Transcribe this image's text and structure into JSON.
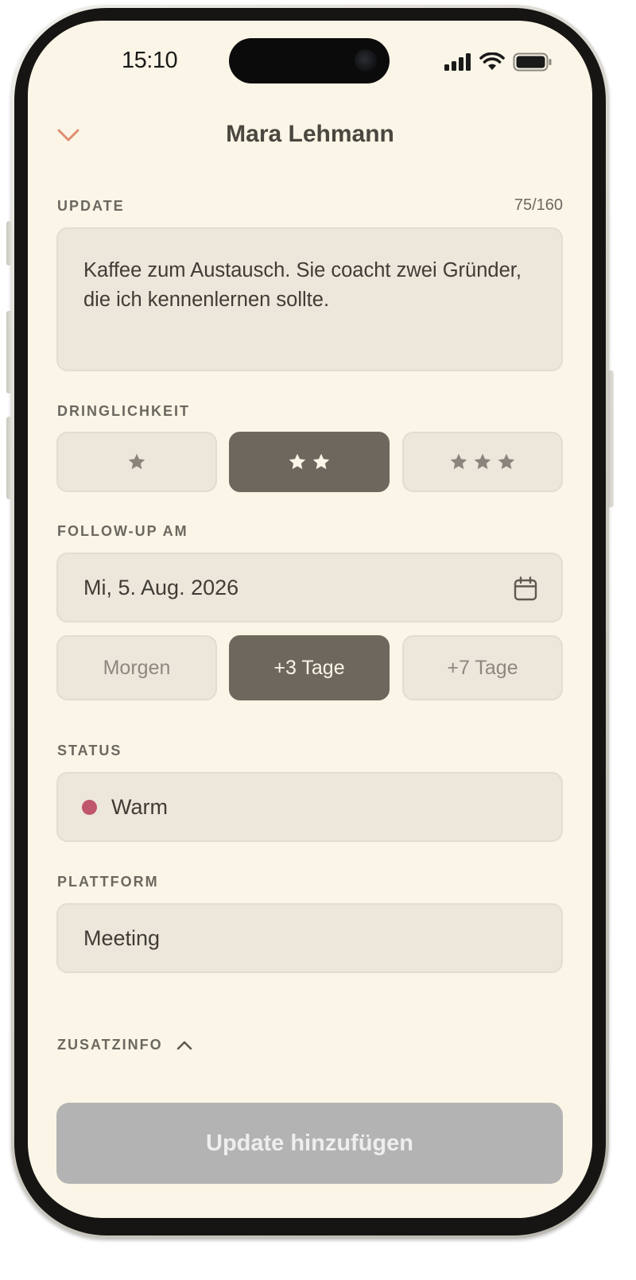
{
  "status_bar": {
    "time": "15:10"
  },
  "header": {
    "title": "Mara Lehmann",
    "back_icon": "chevron-down-icon",
    "accent_color": "#e08d6f"
  },
  "update": {
    "label": "UPDATE",
    "counter": "75/160",
    "text": "Kaffee zum Austausch. Sie coacht zwei Gründer, die ich kennenlernen sollte."
  },
  "urgency": {
    "label": "DRINGLICHKEIT",
    "options": [
      {
        "stars": 1,
        "selected": false
      },
      {
        "stars": 2,
        "selected": true
      },
      {
        "stars": 3,
        "selected": false
      }
    ],
    "selected_stars": 2
  },
  "follow_up": {
    "label": "FOLLOW-UP AM",
    "date": "Mi, 5. Aug. 2026",
    "icon": "calendar-icon",
    "quick_options": [
      {
        "label": "Morgen",
        "selected": false
      },
      {
        "label": "+3 Tage",
        "selected": true
      },
      {
        "label": "+7 Tage",
        "selected": false
      }
    ]
  },
  "status": {
    "label": "STATUS",
    "value": "Warm",
    "dot_color": "#c0566a"
  },
  "platform": {
    "label": "PLATTFORM",
    "value": "Meeting"
  },
  "extra_info": {
    "label": "ZUSATZINFO",
    "icon": "chevron-up-icon"
  },
  "submit": {
    "label": "Update hinzufügen",
    "enabled": false
  },
  "colors": {
    "background": "#faf5e6",
    "field": "#ede6da",
    "selected": "#6e675e",
    "disabled_button": "#b3b3b3"
  }
}
